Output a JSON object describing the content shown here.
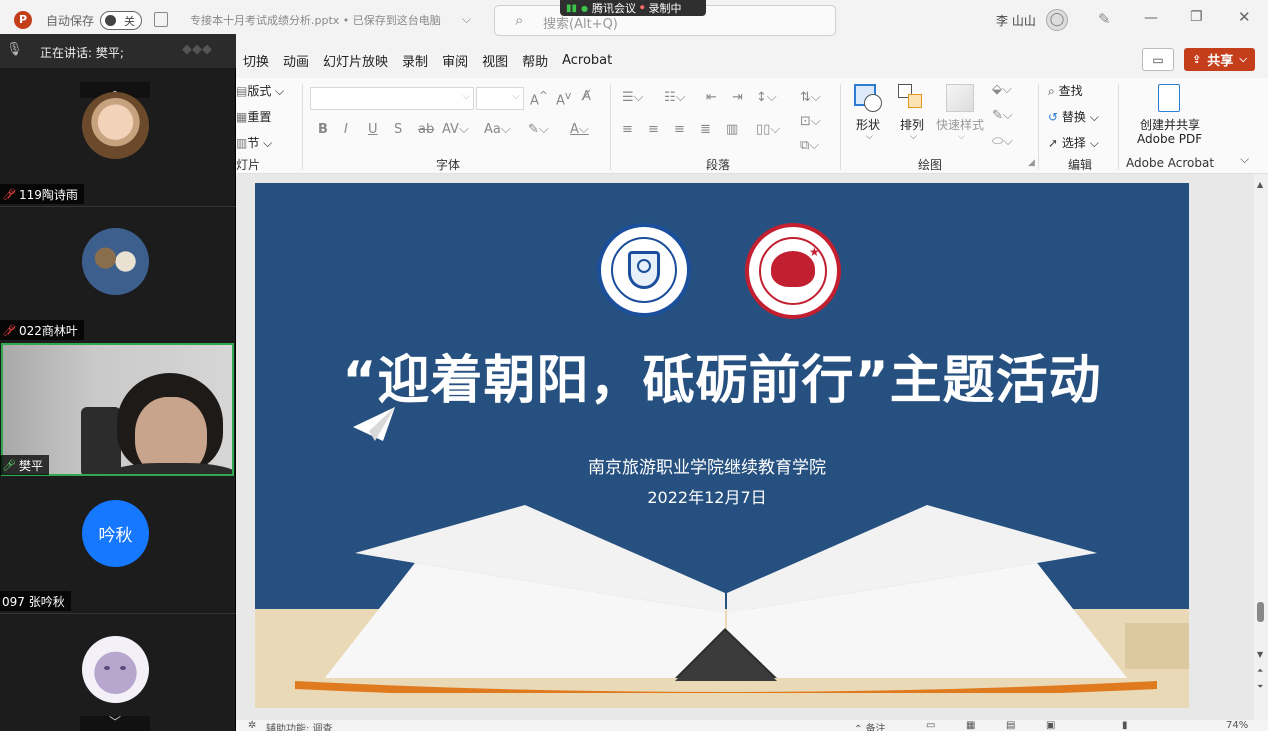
{
  "titlebar": {
    "autosave_label": "自动保存",
    "autosave_state": "关",
    "doc_title": "专接本十月考试成绩分析.pptx • 已保存到这台电脑",
    "search_placeholder": "搜索(Alt+Q)",
    "user_name": "李 山山"
  },
  "meeting": {
    "app_name": "腾讯会议",
    "recording": "录制中",
    "speaking_label": "正在讲话: 樊平;"
  },
  "tabs": [
    "切换",
    "动画",
    "幻灯片放映",
    "录制",
    "审阅",
    "视图",
    "帮助",
    "Acrobat"
  ],
  "share_label": "共享",
  "ribbon": {
    "slides_group": {
      "items": [
        "版式",
        "重置",
        "节"
      ],
      "label": "灯片"
    },
    "font_group": {
      "label": "字体"
    },
    "paragraph_group": {
      "label": "段落"
    },
    "drawing_group": {
      "shapes": "形状",
      "arrange": "排列",
      "quick_styles": "快速样式",
      "label": "绘图"
    },
    "editing_group": {
      "find": "查找",
      "replace": "替换",
      "select": "选择",
      "label": "编辑"
    },
    "acrobat_group": {
      "create_line1": "创建并共享",
      "create_line2": "Adobe PDF",
      "label": "Adobe Acrobat"
    }
  },
  "participants": [
    {
      "name": "119陶诗雨",
      "muted": true
    },
    {
      "name": "022商林叶",
      "muted": true
    },
    {
      "name": "樊平",
      "muted": false
    },
    {
      "name": "097 张吟秋",
      "avatar_text": "吟秋",
      "muted": true
    }
  ],
  "slide": {
    "title": "“迎着朝阳，砥砺前行”主题活动",
    "org": "南京旅游职业学院继续教育学院",
    "date": "2022年12月7日"
  },
  "statusbar": {
    "accessibility": "辅助功能: 调查",
    "notes": "备注",
    "zoom": "74%"
  },
  "colors": {
    "slide_bg": "#26507f",
    "share": "#c43e1c",
    "avatar_blue": "#1677ff"
  }
}
